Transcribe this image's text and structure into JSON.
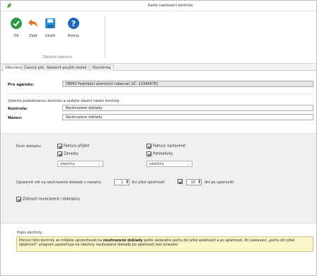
{
  "window": {
    "title": "Karta nastavení kontroly"
  },
  "ribbon": {
    "tools": [
      {
        "label": "OK",
        "icon": "check-circle-icon",
        "color": "#2e9a3e"
      },
      {
        "label": "Zpět",
        "icon": "undo-arrow-icon",
        "color": "#e8762a"
      },
      {
        "label": "Uložit",
        "icon": "save-disk-icon",
        "color": "#2c8fd4"
      },
      {
        "label": "Pomoc",
        "icon": "help-icon",
        "color": "#1e66b8"
      }
    ],
    "group_caption": "Základní operace"
  },
  "tabs": [
    {
      "label": "Ukončené",
      "active": true
    },
    {
      "label": "Časový plán",
      "active": false
    },
    {
      "label": "Nastavit použití složek",
      "active": false
    },
    {
      "label": "Poznámka",
      "active": false
    }
  ],
  "main": {
    "agenda_label": "Pro agendu:",
    "agenda_value": "DEMO Podnikání účetnictví (obecné) [IČ: 12345678]",
    "select_hint": "Vyberte požadovanou kontrolu a zadejte vlastní název kontroly",
    "control_label": "Kontrola:",
    "control_value": "Neuhrazené doklady",
    "name_label": "Název:",
    "name_value": "Neuhrazené doklady"
  },
  "options": {
    "doc_type_label": "Druh dokladu:",
    "checks": {
      "faktury_prijate": "Faktury přijaté",
      "faktury_vydane": "Faktury vystavené",
      "zavazky": "Závazky",
      "pohledavky": "Pohledávky"
    },
    "select_left": "všechny",
    "select_right": "všechny",
    "notify_text": "Upozornit mě na neuhrazené doklady v rozsahu",
    "days_before": "1",
    "before_text": "dní před splatností",
    "days_after": "10",
    "after_text": "dní po splatnosti",
    "show_unmatched": "Zobrazit neuhrazené i dobropisy"
  },
  "note": {
    "label": "Popis kontroly:",
    "text_before": "Pomocí této kontroly se můžete upozorňovat na ",
    "text_bold": "neuhrazené doklady",
    "text_after": " podle zadaného počtu dní před splatností a po splatnosti. Po nastavení „počtu dní před splatností“ program upozorňuje na všechny neuhrazené doklady po splatnosti bez omezení."
  },
  "colors": {
    "note_bg": "#fbf7c8",
    "options_bg": "#f0f0f0"
  }
}
